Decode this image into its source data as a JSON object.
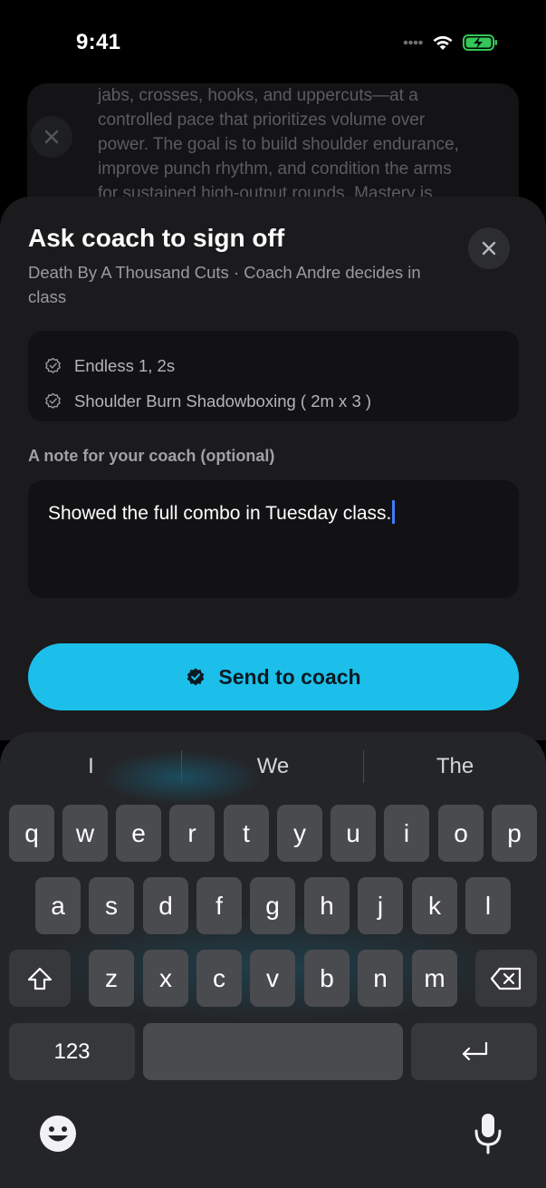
{
  "status": {
    "time": "9:41"
  },
  "background": {
    "lines": [
      "jabs, crosses, hooks, and uppercuts—at a",
      "controlled pace that prioritizes volume over",
      "power. The goal is to build shoulder endurance,",
      "improve punch rhythm, and condition the arms",
      "for sustained high-output rounds. Mastery is"
    ]
  },
  "sheet": {
    "title": "Ask coach to sign off",
    "subtitle": "Death By A Thousand Cuts · Coach Andre decides in class",
    "requirements": [
      "Endless 1, 2s",
      "Shoulder Burn Shadowboxing ( 2m x 3 )"
    ],
    "note_label": "A note for your coach (optional)",
    "note_value": "Showed the full combo in Tuesday class.",
    "send_label": "Send to coach"
  },
  "keyboard": {
    "suggestions": [
      "I",
      "We",
      "The"
    ],
    "row1": [
      "q",
      "w",
      "e",
      "r",
      "t",
      "y",
      "u",
      "i",
      "o",
      "p"
    ],
    "row2": [
      "a",
      "s",
      "d",
      "f",
      "g",
      "h",
      "j",
      "k",
      "l"
    ],
    "row3": [
      "z",
      "x",
      "c",
      "v",
      "b",
      "n",
      "m"
    ],
    "numbers_label": "123"
  },
  "colors": {
    "accent": "#1cbfea",
    "caret": "#3f7dff",
    "battery": "#34c759"
  }
}
